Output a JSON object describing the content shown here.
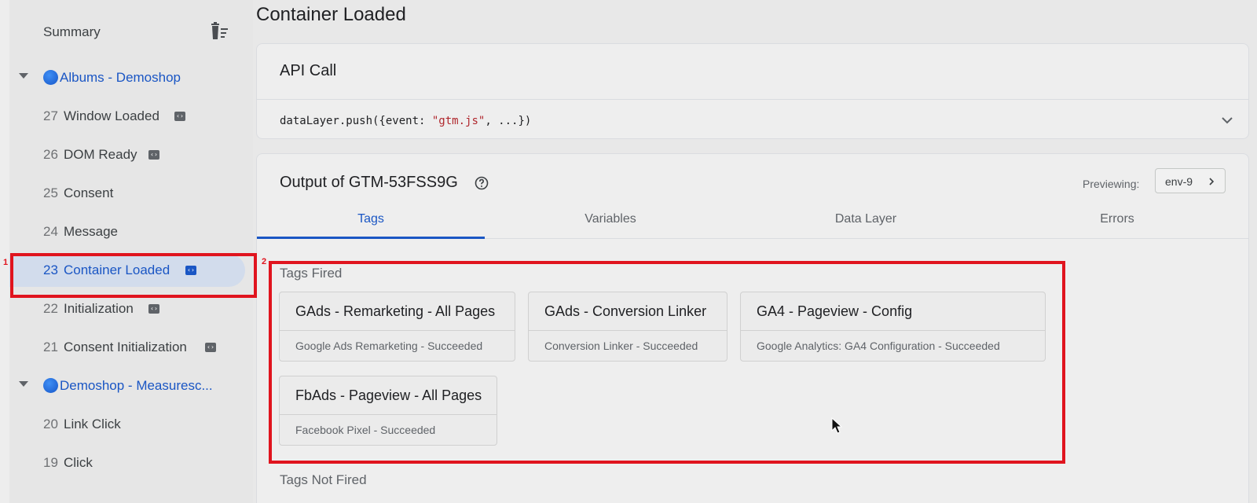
{
  "sidebar": {
    "summary_label": "Summary",
    "groups": [
      {
        "name": "Albums - Demoshop"
      },
      {
        "name": "Demoshop - Measuresc..."
      }
    ],
    "items": [
      {
        "num": "27",
        "name": "Window Loaded"
      },
      {
        "num": "26",
        "name": "DOM Ready"
      },
      {
        "num": "25",
        "name": "Consent"
      },
      {
        "num": "24",
        "name": "Message"
      },
      {
        "num": "23",
        "name": "Container Loaded"
      },
      {
        "num": "22",
        "name": "Initialization"
      },
      {
        "num": "21",
        "name": "Consent Initialization"
      },
      {
        "num": "20",
        "name": "Link Click"
      },
      {
        "num": "19",
        "name": "Click"
      }
    ]
  },
  "main": {
    "title": "Container Loaded",
    "api_call": {
      "title": "API Call",
      "code_prefix": "dataLayer.push({event: ",
      "code_string": "\"gtm.js\"",
      "code_suffix": ", ...})"
    },
    "output": {
      "title": "Output of GTM-53FSS9G",
      "previewing_label": "Previewing:",
      "env": "env-9",
      "tabs": [
        {
          "label": "Tags"
        },
        {
          "label": "Variables"
        },
        {
          "label": "Data Layer"
        },
        {
          "label": "Errors"
        }
      ],
      "tags_fired_label": "Tags Fired",
      "tags_not_fired_label": "Tags Not Fired",
      "tags_fired": [
        {
          "name": "GAds - Remarketing - All Pages",
          "status": "Google Ads Remarketing - Succeeded"
        },
        {
          "name": "GAds - Conversion Linker",
          "status": "Conversion Linker - Succeeded"
        },
        {
          "name": "GA4 - Pageview - Config",
          "status": "Google Analytics: GA4 Configuration - Succeeded"
        },
        {
          "name": "FbAds - Pageview - All Pages",
          "status": "Facebook Pixel - Succeeded"
        }
      ]
    }
  },
  "annotations": {
    "box1": "1",
    "box2": "2"
  },
  "colors": {
    "accent": "#1a56c4",
    "highlight": "#e0141e"
  }
}
